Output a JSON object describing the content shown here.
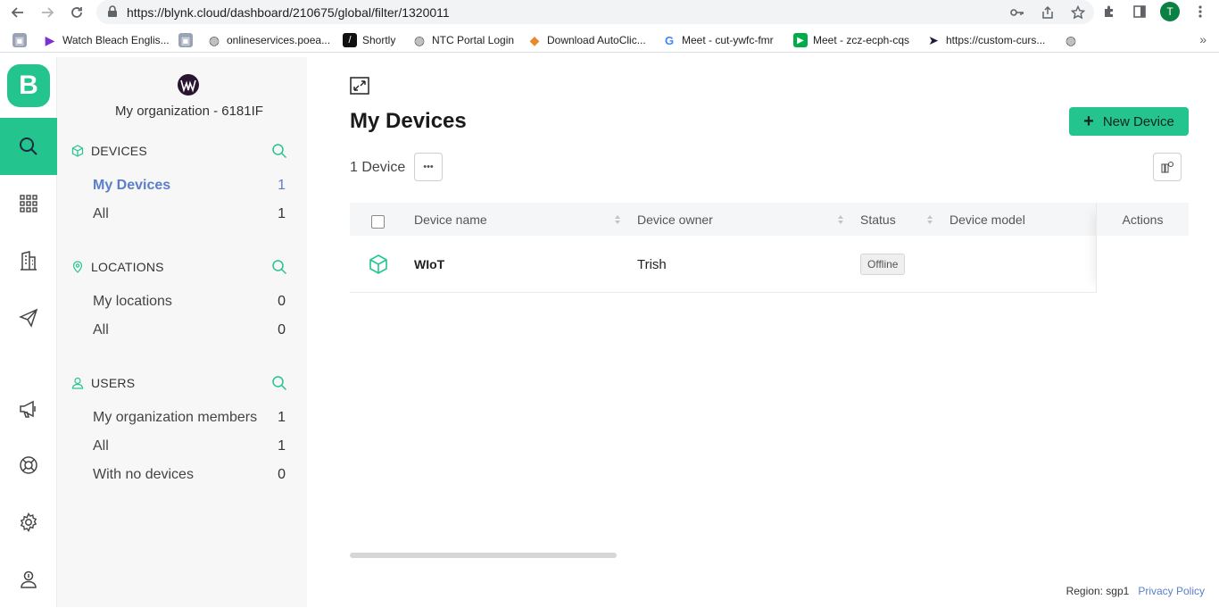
{
  "browser": {
    "url": "https://blynk.cloud/dashboard/210675/global/filter/1320011",
    "profile_initial": "T",
    "bookmarks": [
      {
        "label": "",
        "icon": "image-icon"
      },
      {
        "label": "Watch Bleach Englis...",
        "icon": "play-icon"
      },
      {
        "label": "",
        "icon": "image-icon"
      },
      {
        "label": "onlineservices.poea...",
        "icon": "globe-icon"
      },
      {
        "label": "Shortly",
        "icon": "shortly-icon"
      },
      {
        "label": "NTC Portal Login",
        "icon": "globe-icon"
      },
      {
        "label": "Download AutoClic...",
        "icon": "diamond-icon"
      },
      {
        "label": "Meet - cut-ywfc-fmr",
        "icon": "google-icon"
      },
      {
        "label": "Meet - zcz-ecph-cqs",
        "icon": "meet-icon"
      },
      {
        "label": "https://custom-curs...",
        "icon": "cursor-icon"
      },
      {
        "label": "",
        "icon": "globe-icon"
      }
    ]
  },
  "rail": {
    "logo_letter": "B",
    "items": [
      "search-icon",
      "apps-grid-icon",
      "building-icon",
      "send-icon",
      "megaphone-icon",
      "lifebuoy-icon",
      "gear-icon",
      "user-badge-icon"
    ]
  },
  "sidebar": {
    "org_name": "My organization - 6181IF",
    "devices": {
      "title": "DEVICES",
      "items": [
        {
          "label": "My Devices",
          "count": "1"
        },
        {
          "label": "All",
          "count": "1"
        }
      ]
    },
    "locations": {
      "title": "LOCATIONS",
      "items": [
        {
          "label": "My locations",
          "count": "0"
        },
        {
          "label": "All",
          "count": "0"
        }
      ]
    },
    "users": {
      "title": "USERS",
      "items": [
        {
          "label": "My organization members",
          "count": "1"
        },
        {
          "label": "All",
          "count": "1"
        },
        {
          "label": "With no devices",
          "count": "0"
        }
      ]
    }
  },
  "main": {
    "title": "My Devices",
    "new_device_label": "New Device",
    "device_count": "1 Device",
    "more_label": "•••",
    "table": {
      "headers": {
        "name": "Device name",
        "owner": "Device owner",
        "status": "Status",
        "model": "Device model",
        "actions": "Actions"
      },
      "rows": [
        {
          "name": "WIoT",
          "owner": "Trish",
          "status": "Offline",
          "model": ""
        }
      ]
    }
  },
  "footer": {
    "region": "Region: sgp1",
    "privacy": "Privacy Policy"
  },
  "colors": {
    "accent": "#23c48e",
    "link": "#5b7fc8"
  }
}
